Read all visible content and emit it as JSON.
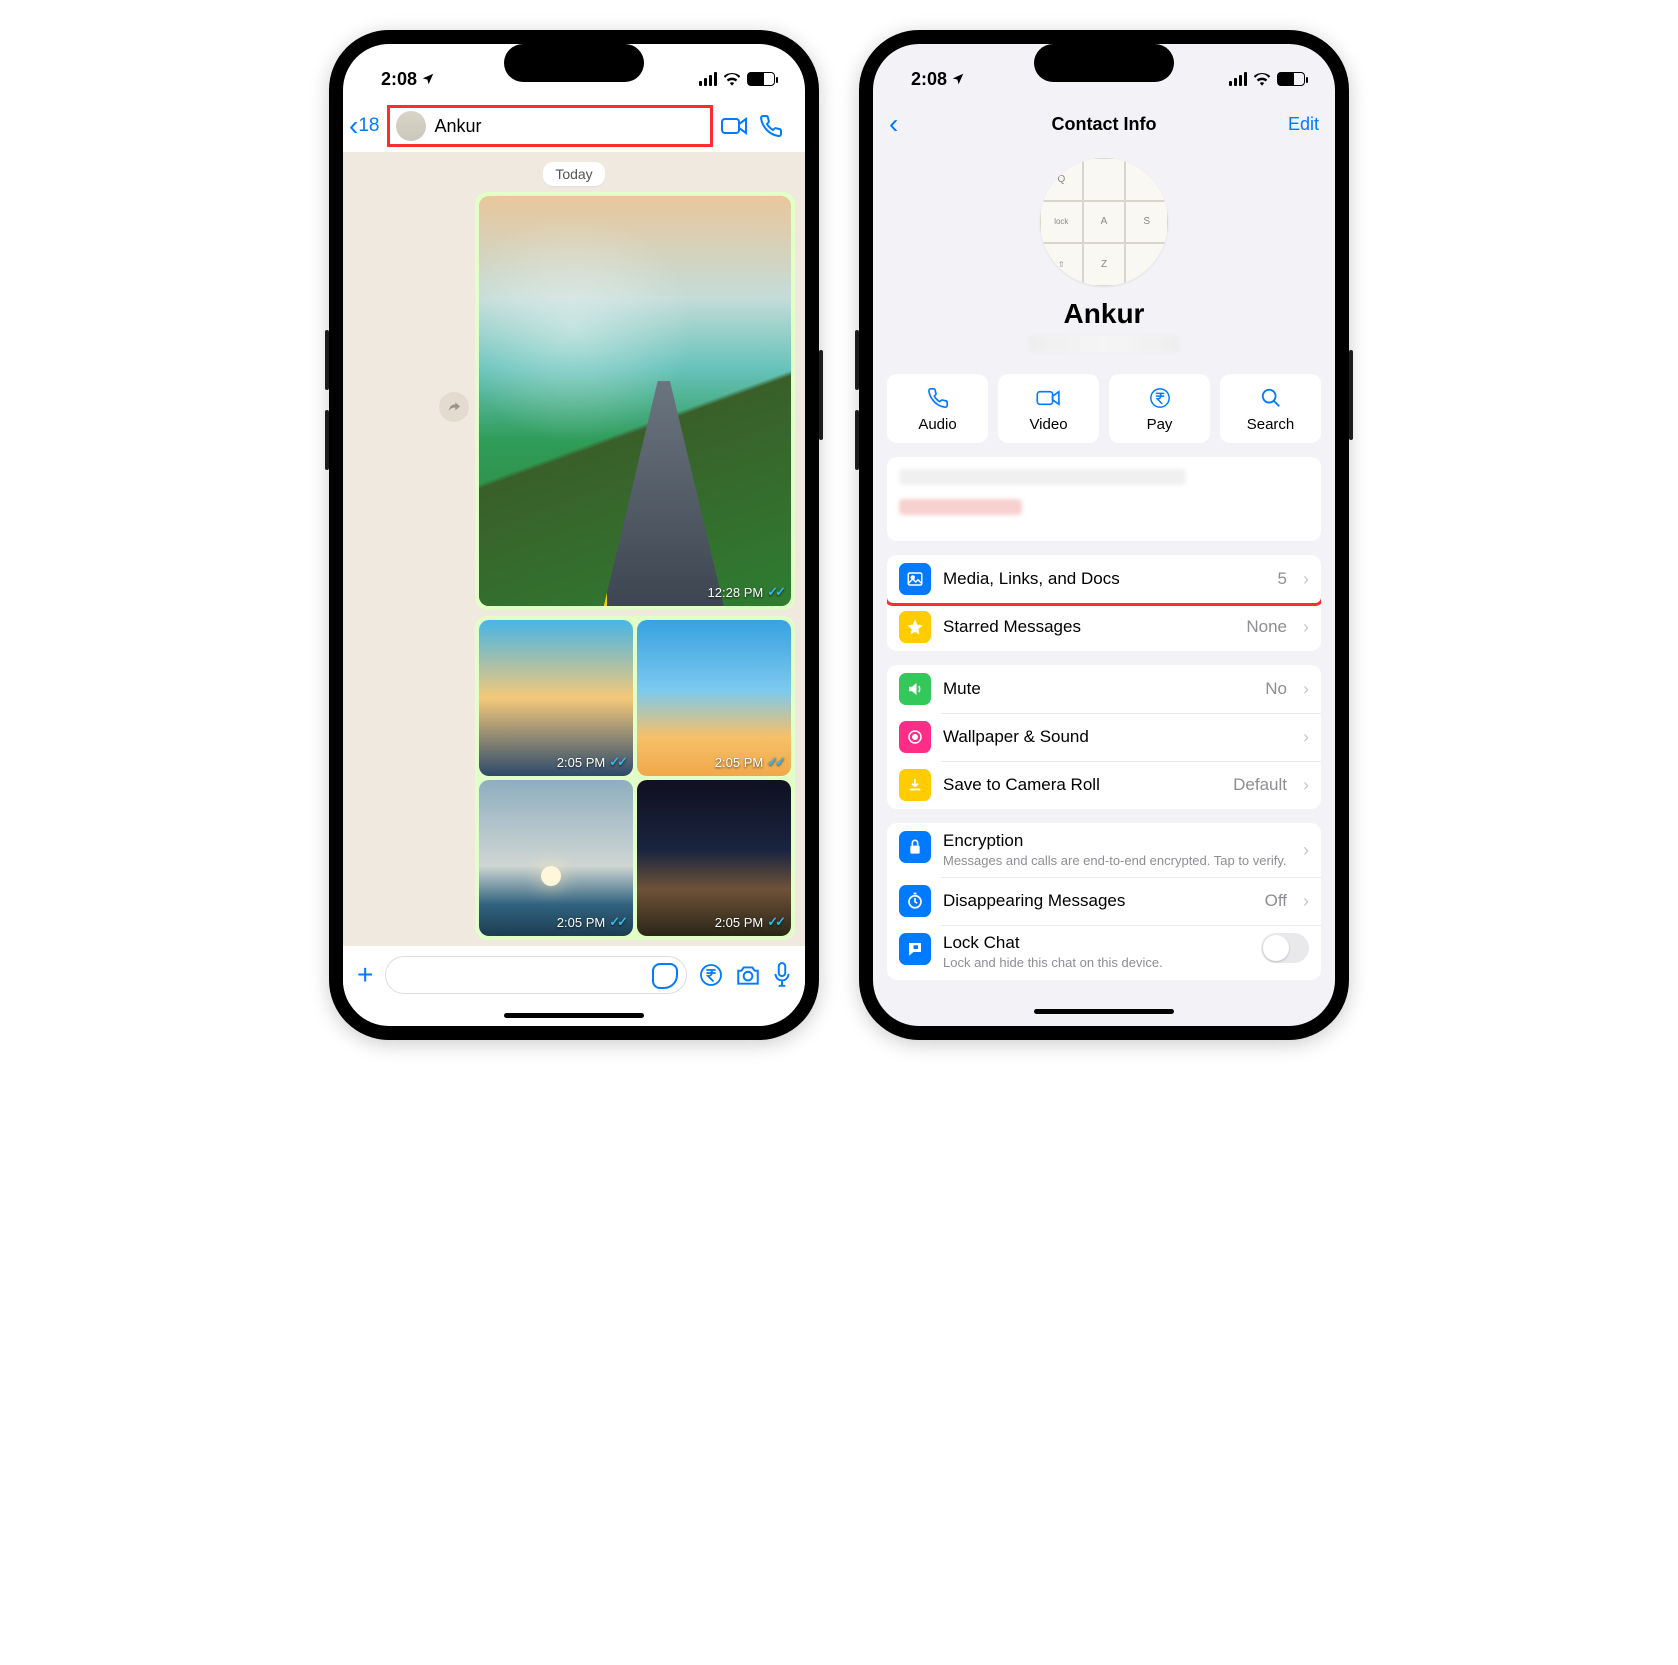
{
  "status": {
    "time": "2:08"
  },
  "phone1": {
    "back_count": "18",
    "contact_name": "Ankur",
    "date_label": "Today",
    "msg1_time": "12:28 PM",
    "msg2_time": "2:05 PM",
    "msg3_time": "2:05 PM",
    "msg4_time": "2:05 PM",
    "msg5_time": "2:05 PM"
  },
  "phone2": {
    "title": "Contact Info",
    "edit": "Edit",
    "name": "Ankur",
    "actions": {
      "audio": "Audio",
      "video": "Video",
      "pay": "Pay",
      "search": "Search"
    },
    "rows": {
      "media": {
        "label": "Media, Links, and Docs",
        "value": "5"
      },
      "starred": {
        "label": "Starred Messages",
        "value": "None"
      },
      "mute": {
        "label": "Mute",
        "value": "No"
      },
      "wallpaper": {
        "label": "Wallpaper & Sound"
      },
      "camera_roll": {
        "label": "Save to Camera Roll",
        "value": "Default"
      },
      "encryption": {
        "label": "Encryption",
        "sub": "Messages and calls are end-to-end encrypted. Tap to verify."
      },
      "disappearing": {
        "label": "Disappearing Messages",
        "value": "Off"
      },
      "lock": {
        "label": "Lock Chat",
        "sub": "Lock and hide this chat on this device."
      }
    }
  }
}
